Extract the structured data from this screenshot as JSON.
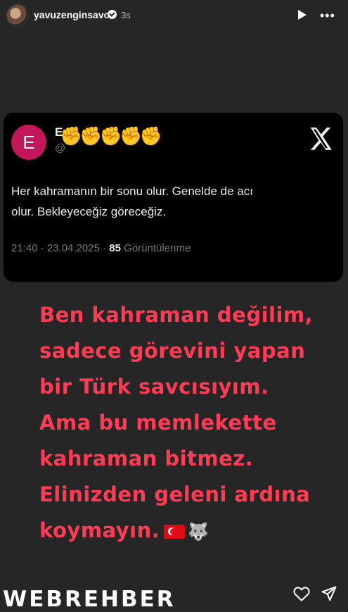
{
  "header": {
    "username": "yavuzenginsavci",
    "time_ago": "3s"
  },
  "tweet": {
    "avatar_letter": "E",
    "name_partial": "E",
    "handle_partial": "@",
    "emoji_overlay": "✊✊✊✊✊",
    "text_line1": "Her kahramanın bir sonu olur. Genelde de acı",
    "text_line2": "olur. Bekleyeceğiz göreceğiz.",
    "meta_prefix": "21:40 · 23.04.2025 · ",
    "views_count": "85",
    "views_label": "Görüntülenme"
  },
  "caption": {
    "lines": [
      "Ben kahraman değilim,",
      "sadece görevini yapan",
      "bir Türk savcısıyım.",
      "Ama bu memlekette",
      "kahraman bitmez.",
      "Elinizden geleni ardına",
      "koymayın."
    ],
    "color": "#ff3b55"
  },
  "footer": {
    "watermark": "WEBREHBER"
  }
}
